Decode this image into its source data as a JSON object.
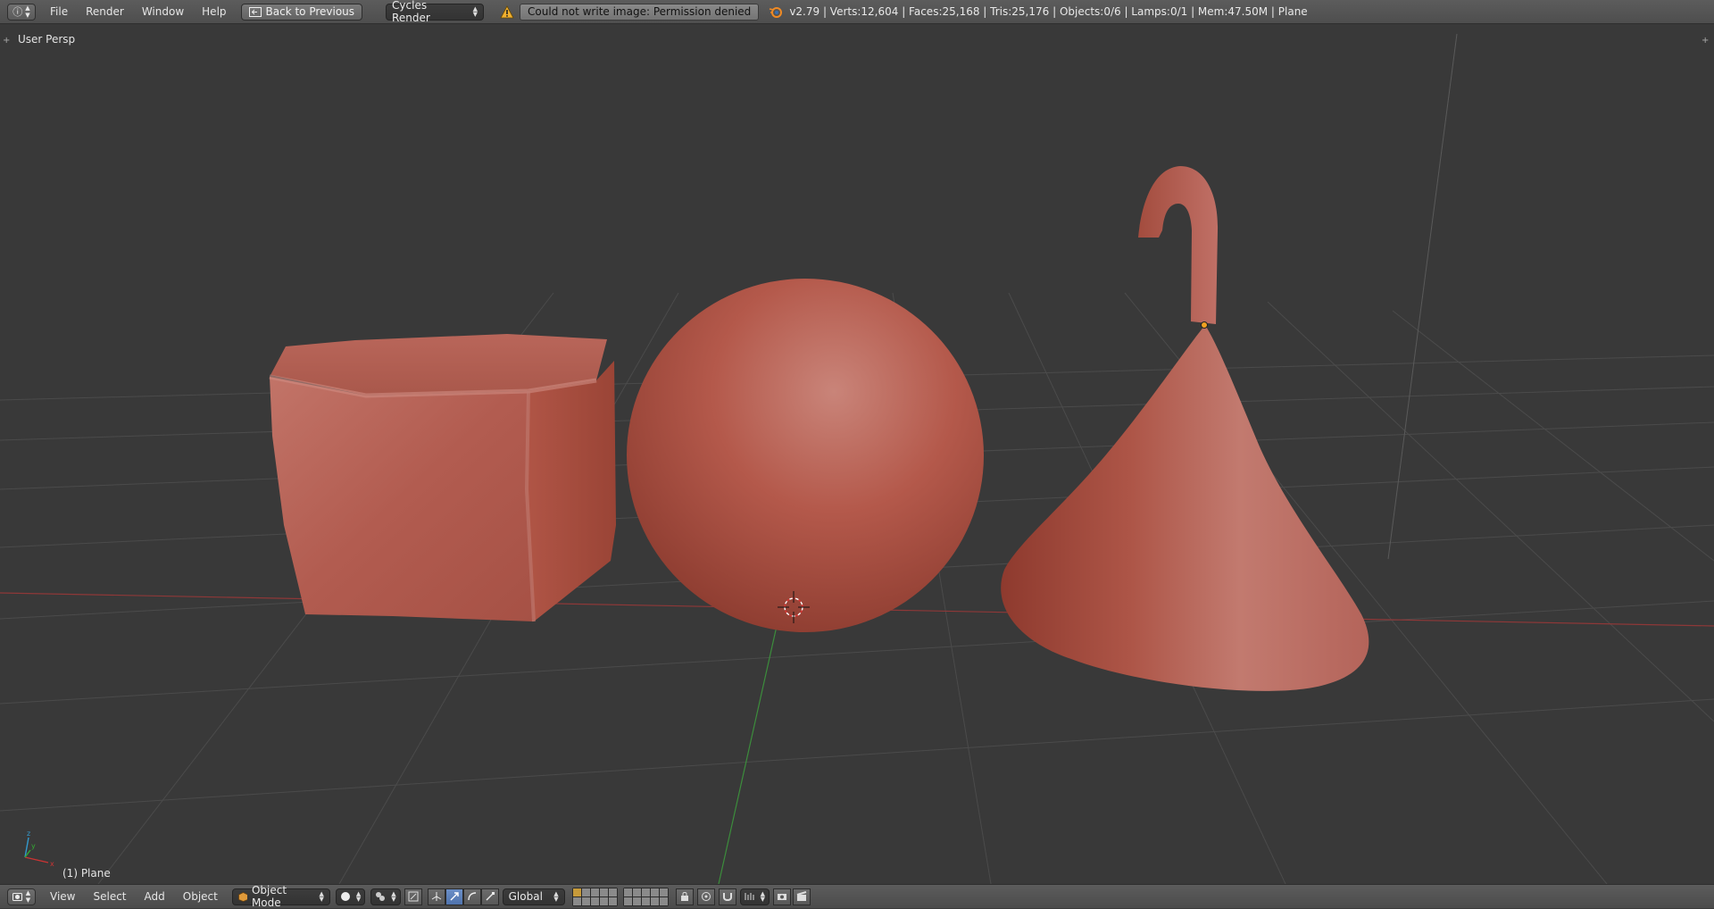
{
  "top_header": {
    "editor_icon": "info-icon",
    "menus": [
      "File",
      "Render",
      "Window",
      "Help"
    ],
    "back_button": "Back to Previous",
    "render_engine": "Cycles Render",
    "warning": "Could not write image: Permission denied",
    "stats": "v2.79 | Verts:12,604 | Faces:25,168 | Tris:25,176 | Objects:0/6 | Lamps:0/1 | Mem:47.50M | Plane"
  },
  "viewport": {
    "view_name": "User Persp",
    "active_object": "(1) Plane",
    "object_color": "#b85a4c",
    "grid_color": "#4a4a4a",
    "x_axis_color": "#9b3a3a",
    "y_axis_color": "#3b8a3b"
  },
  "bottom_header": {
    "editor_icon": "3d-view-icon",
    "menus": [
      "View",
      "Select",
      "Add",
      "Object"
    ],
    "mode": "Object Mode",
    "transform_orientation": "Global"
  }
}
